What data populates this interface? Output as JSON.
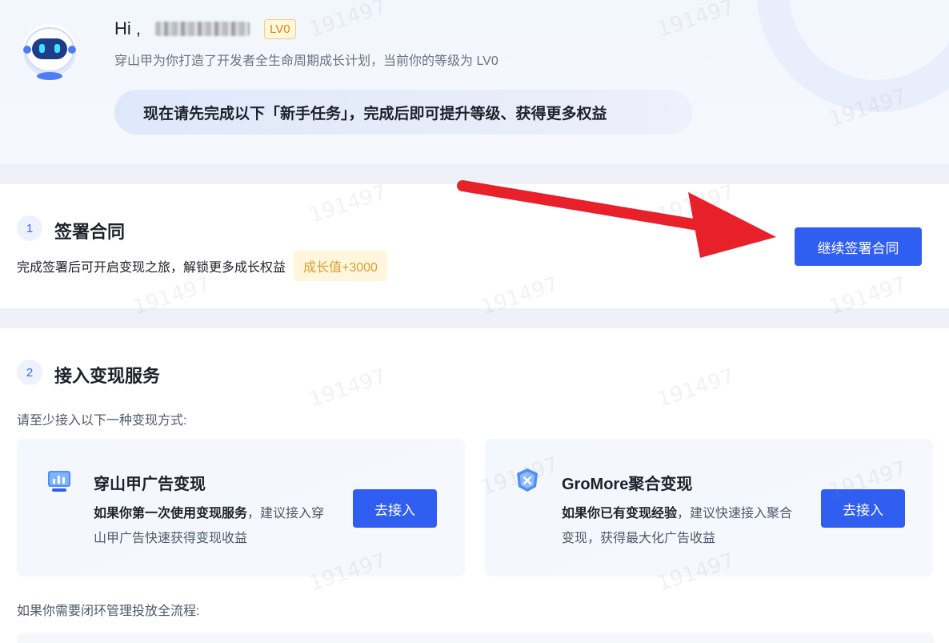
{
  "header": {
    "greeting": "Hi ,",
    "level_badge": "LV0",
    "subtitle": "穿山甲为你打造了开发者全生命周期成长计划，当前你的等级为 LV0",
    "task_banner": "现在请先完成以下「新手任务」，完成后即可提升等级、获得更多权益"
  },
  "step1": {
    "number": "1",
    "title": "签署合同",
    "description": "完成签署后可开启变现之旅，解锁更多成长权益",
    "growth_tag": "成长值+3000",
    "button": "继续签署合同"
  },
  "step2": {
    "number": "2",
    "title": "接入变现服务",
    "hint": "请至少接入以下一种变现方式:",
    "cards": [
      {
        "title": "穿山甲广告变现",
        "desc_bold": "如果你第一次使用变现服务",
        "desc_rest": "，建议接入穿山甲广告快速获得变现收益",
        "button": "去接入",
        "icon": "chart-monitor-icon"
      },
      {
        "title": "GroMore聚合变现",
        "desc_bold": "如果你已有变现经验",
        "desc_rest": "，建议快速接入聚合变现，获得最大化广告收益",
        "button": "去接入",
        "icon": "aggregate-shield-icon"
      }
    ],
    "bottom_hint": "如果你需要闭环管理投放全流程:"
  },
  "watermark": "191497",
  "colors": {
    "primary": "#2f5ef0",
    "annotation_arrow": "#e8202a",
    "growth_tag_text": "#d9a032"
  }
}
